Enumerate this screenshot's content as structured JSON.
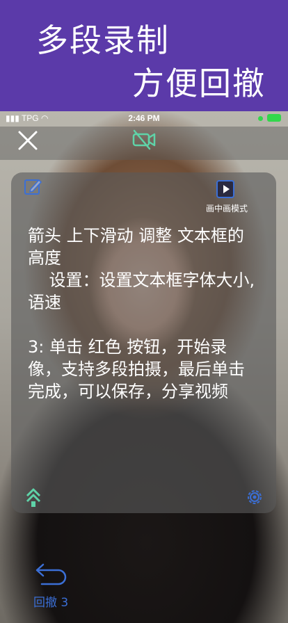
{
  "banner": {
    "line1": "多段录制",
    "line2": "方便回撤"
  },
  "status_bar": {
    "carrier": "TPG",
    "time": "2:46 PM"
  },
  "toolbar": {
    "close_icon": "close-icon",
    "camera_icon": "video-off-icon"
  },
  "panel": {
    "edit_icon": "edit-icon",
    "pip_icon": "play-square-icon",
    "pip_label": "画中画模式",
    "script_text": "箭头 上下滑动 调整 文本框的高度\n    设置：设置文本框字体大小, 语速\n\n3: 单击 红色 按钮，开始录像，支持多段拍摄，最后单击完成，可以保存，分享视频",
    "up_icon": "double-chevron-up-icon",
    "settings_icon": "gear-icon"
  },
  "undo": {
    "icon": "undo-arrow-icon",
    "label": "回撤 3"
  },
  "colors": {
    "banner_bg": "#5b3aa9",
    "accent_green": "#5fd3a8",
    "accent_blue": "#3b6fd6",
    "battery_green": "#32d74b"
  }
}
